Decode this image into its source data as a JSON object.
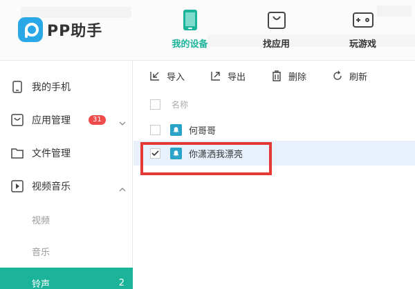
{
  "app": {
    "logo_text": "PP助手",
    "brand_color": "#2aa7e6",
    "accent_color": "#1bb39a"
  },
  "nav": {
    "tabs": [
      {
        "label": "我的设备",
        "icon": "phone-icon",
        "active": true
      },
      {
        "label": "找应用",
        "icon": "shopping-bag-icon",
        "active": false
      },
      {
        "label": "玩游戏",
        "icon": "gamepad-icon",
        "active": false
      }
    ]
  },
  "sidebar": {
    "items": [
      {
        "label": "我的手机",
        "icon": "phone-icon"
      },
      {
        "label": "应用管理",
        "icon": "app-manage-icon",
        "badge": "31"
      },
      {
        "label": "文件管理",
        "icon": "folder-icon"
      },
      {
        "label": "视频音乐",
        "icon": "play-icon"
      }
    ],
    "sub_items": [
      {
        "label": "视频"
      },
      {
        "label": "音乐"
      },
      {
        "label": "铃声",
        "count": "2",
        "active": true
      }
    ]
  },
  "toolbar": {
    "import_label": "导入",
    "export_label": "导出",
    "delete_label": "删除",
    "refresh_label": "刷新"
  },
  "list": {
    "header_label": "名称",
    "rows": [
      {
        "name": "何哥哥",
        "checked": false
      },
      {
        "name": "你潇洒我漂亮",
        "checked": true
      }
    ],
    "highlight_color": "#e53935"
  }
}
